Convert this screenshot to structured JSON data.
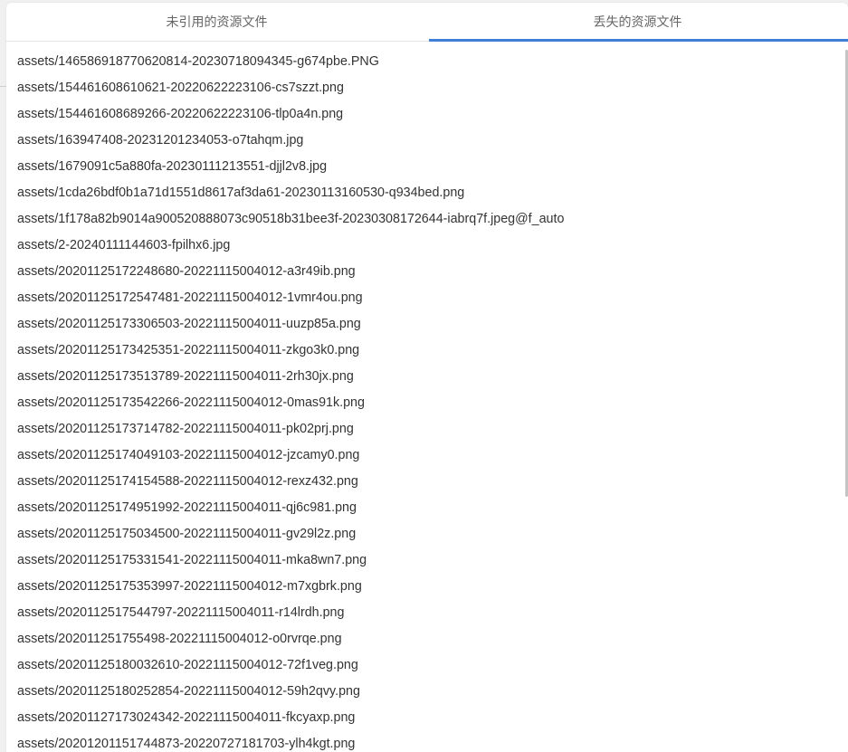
{
  "tabs": [
    {
      "label": "未引用的资源文件",
      "active": false
    },
    {
      "label": "丢失的资源文件",
      "active": true
    }
  ],
  "colors": {
    "accent": "#3f7fd8",
    "text": "#333333",
    "tab_text": "#666666"
  },
  "files": [
    "assets/146586918770620814-20230718094345-g674pbe.PNG",
    "assets/154461608610621-20220622223106-cs7szzt.png",
    "assets/154461608689266-20220622223106-tlp0a4n.png",
    "assets/163947408-20231201234053-o7tahqm.jpg",
    "assets/1679091c5a880fa-20230111213551-djjl2v8.jpg",
    "assets/1cda26bdf0b1a71d1551d8617af3da61-20230113160530-q934bed.png",
    "assets/1f178a82b9014a900520888073c90518b31bee3f-20230308172644-iabrq7f.jpeg@f_auto",
    "assets/2-20240111144603-fpilhx6.jpg",
    "assets/20201125172248680-20221115004012-a3r49ib.png",
    "assets/20201125172547481-20221115004012-1vmr4ou.png",
    "assets/20201125173306503-20221115004011-uuzp85a.png",
    "assets/20201125173425351-20221115004011-zkgo3k0.png",
    "assets/20201125173513789-20221115004011-2rh30jx.png",
    "assets/20201125173542266-20221115004012-0mas91k.png",
    "assets/20201125173714782-20221115004011-pk02prj.png",
    "assets/20201125174049103-20221115004012-jzcamy0.png",
    "assets/20201125174154588-20221115004012-rexz432.png",
    "assets/20201125174951992-20221115004011-qj6c981.png",
    "assets/20201125175034500-20221115004011-gv29l2z.png",
    "assets/20201125175331541-20221115004011-mka8wn7.png",
    "assets/20201125175353997-20221115004012-m7xgbrk.png",
    "assets/2020112517544797-20221115004011-r14lrdh.png",
    "assets/202011251755498-20221115004012-o0rvrqe.png",
    "assets/20201125180032610-20221115004012-72f1veg.png",
    "assets/20201125180252854-20221115004012-59h2qvy.png",
    "assets/20201127173024342-20221115004011-fkcyaxp.png",
    "assets/20201201151744873-20220727181703-ylh4kgt.png"
  ]
}
